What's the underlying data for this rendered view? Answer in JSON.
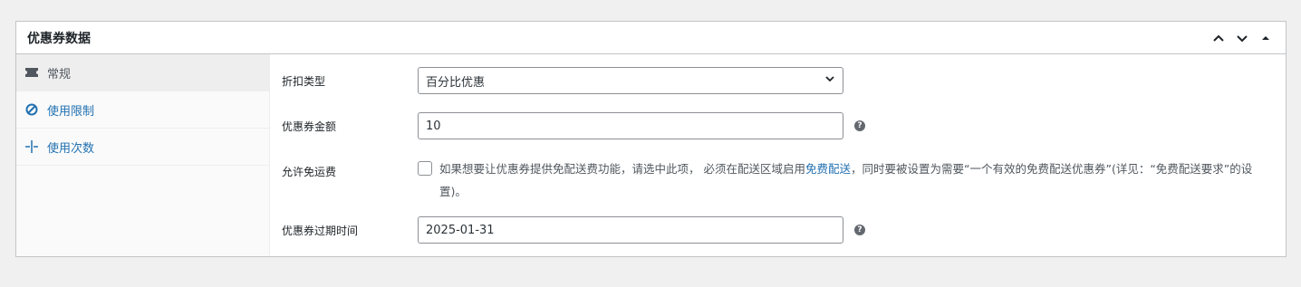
{
  "panel": {
    "title": "优惠券数据"
  },
  "tabs": [
    {
      "label": "常规",
      "icon": "ticket-icon"
    },
    {
      "label": "使用限制",
      "icon": "ban-icon"
    },
    {
      "label": "使用次数",
      "icon": "crosshair-icon"
    }
  ],
  "fields": {
    "discount_type": {
      "label": "折扣类型",
      "value": "百分比优惠"
    },
    "amount": {
      "label": "优惠券金额",
      "value": "10"
    },
    "free_shipping": {
      "label": "允许免运费",
      "text_before": "如果想要让优惠券提供免配送费功能，请选中此项， 必须在配送区域启用",
      "link_text": "免费配送",
      "text_after": "，同时要被设置为需要“一个有效的免费配送优惠券”(详见：“免费配送要求”的设置)。"
    },
    "expiry": {
      "label": "优惠券过期时间",
      "value": "2025-01-31"
    }
  },
  "colors": {
    "link": "#2271b1",
    "border": "#c3c4c7",
    "help": "#646970"
  }
}
